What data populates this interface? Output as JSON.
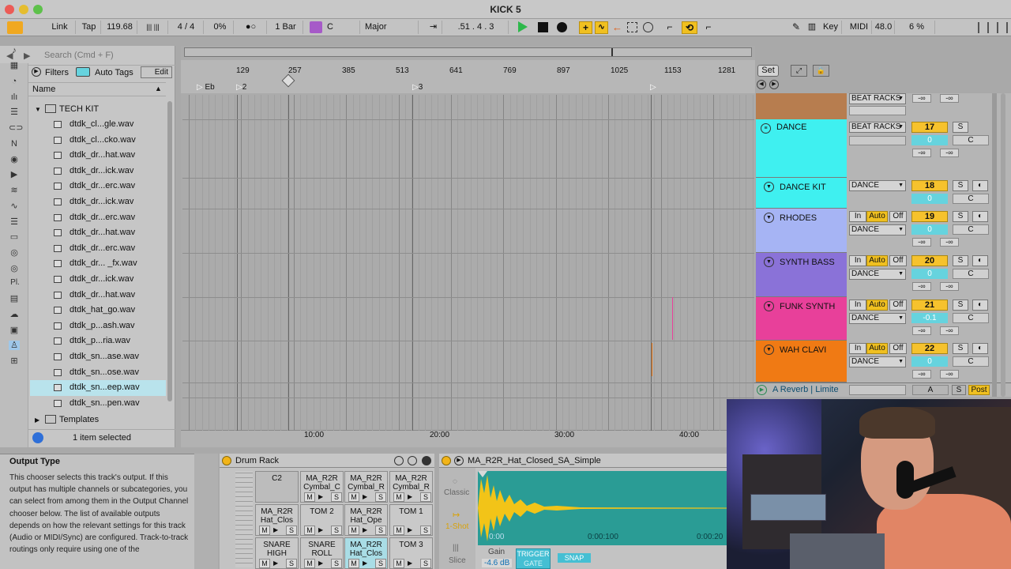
{
  "window": {
    "title": "KICK 5"
  },
  "controlbar": {
    "link": "Link",
    "tap": "Tap",
    "bpm": "119.68",
    "signature": "4 / 4",
    "groove": "0%",
    "metro_dot": "●○",
    "quantize": "1 Bar",
    "key": "C",
    "scale": "Major",
    "position": ".51 . 4 . 3",
    "key_btn": "Key",
    "midi_btn": "MIDI",
    "sample_rate": "48.0",
    "cpu": "6 %"
  },
  "browser": {
    "search_placeholder": "Search (Cmd + F)",
    "filters": "Filters",
    "auto_tags": "Auto Tags",
    "edit": "Edit",
    "name_header": "Name",
    "folder": "TECH KIT",
    "files": [
      "dtdk_cl...gle.wav",
      "dtdk_cl...cko.wav",
      "dtdk_dr...hat.wav",
      "dtdk_dr...ick.wav",
      "dtdk_dr...erc.wav",
      "dtdk_dr...ick.wav",
      "dtdk_dr...erc.wav",
      "dtdk_dr...hat.wav",
      "dtdk_dr...erc.wav",
      "dtdk_dr... _fx.wav",
      "dtdk_dr...ick.wav",
      "dtdk_dr...hat.wav",
      "dtdk_hat_go.wav",
      "dtdk_p...ash.wav",
      "dtdk_p...ria.wav",
      "dtdk_sn...ase.wav",
      "dtdk_sn...ose.wav",
      "dtdk_sn...eep.wav",
      "dtdk_sn...pen.wav"
    ],
    "templates": "Templates",
    "status": "1 item selected",
    "places_label": "Pl."
  },
  "arrangement": {
    "ruler": [
      "129",
      "257",
      "385",
      "513",
      "641",
      "769",
      "897",
      "1025",
      "1153",
      "1281"
    ],
    "markers": [
      "Eb",
      "2",
      "3"
    ],
    "time": [
      "10:00",
      "20:00",
      "30:00",
      "40:00"
    ],
    "set_btn": "Set"
  },
  "tracks": [
    {
      "name": "DANCE",
      "color": "#3ff0f0",
      "routing": "BEAT RACKS",
      "num": "17",
      "vol": "0",
      "pan": "C",
      "s": "S"
    },
    {
      "name": "DANCE KIT",
      "color": "#3ff0f0",
      "routing": "DANCE",
      "num": "18",
      "vol": "0",
      "pan": "C",
      "s": "S"
    },
    {
      "name": "RHODES",
      "color": "#a6b4f4",
      "routing": "DANCE",
      "num": "19",
      "vol": "0",
      "pan": "C",
      "s": "S"
    },
    {
      "name": "SYNTH BASS",
      "color": "#8a72d8",
      "routing": "DANCE",
      "num": "20",
      "vol": "0",
      "pan": "C",
      "s": "S"
    },
    {
      "name": "FUNK SYNTH",
      "color": "#e8409a",
      "routing": "DANCE",
      "num": "21",
      "vol": "-0.1",
      "pan": "C",
      "s": "S"
    },
    {
      "name": "WAH CLAVI",
      "color": "#f07a14",
      "routing": "DANCE",
      "num": "22",
      "vol": "0",
      "pan": "C",
      "s": "S"
    }
  ],
  "mixer": {
    "top_routing": "BEAT RACKS",
    "in": "In",
    "auto": "Auto",
    "off": "Off",
    "neg_inf": "-∞",
    "return_track": "A Reverb | Limite",
    "return_letter": "A",
    "post": "Post"
  },
  "info": {
    "title": "Output Type",
    "text": "This chooser selects this track's output. If this output has multiple channels or subcategories, you can select from among them in the Output Channel chooser below. The list of available outputs depends on how the relevant settings for this track (Audio or MIDI/Sync) are configured. Track-to-track routings only require using one of the"
  },
  "drum": {
    "title": "Drum Rack",
    "pads": [
      "C2",
      "MA_R2R Cymbal_C",
      "MA_R2R Cymbal_R",
      "MA_R2R Cymbal_R",
      "MA_R2R Hat_Clos",
      "TOM 2",
      "MA_R2R Hat_Ope",
      "TOM 1",
      "SNARE HIGH",
      "SNARE ROLL",
      "MA_R2R Hat_Clos",
      "TOM 3"
    ],
    "m": "M",
    "s": "S"
  },
  "sampler": {
    "title": "MA_R2R_Hat_Closed_SA_Simple",
    "modes": [
      "Classic",
      "1-Shot",
      "Slice"
    ],
    "times": [
      "0:00",
      "0:00:100",
      "0:00:20"
    ],
    "gain_label": "Gain",
    "gain": "-4.6 dB",
    "trigger": "TRIGGER",
    "gate": "GATE",
    "snap": "SNAP"
  }
}
